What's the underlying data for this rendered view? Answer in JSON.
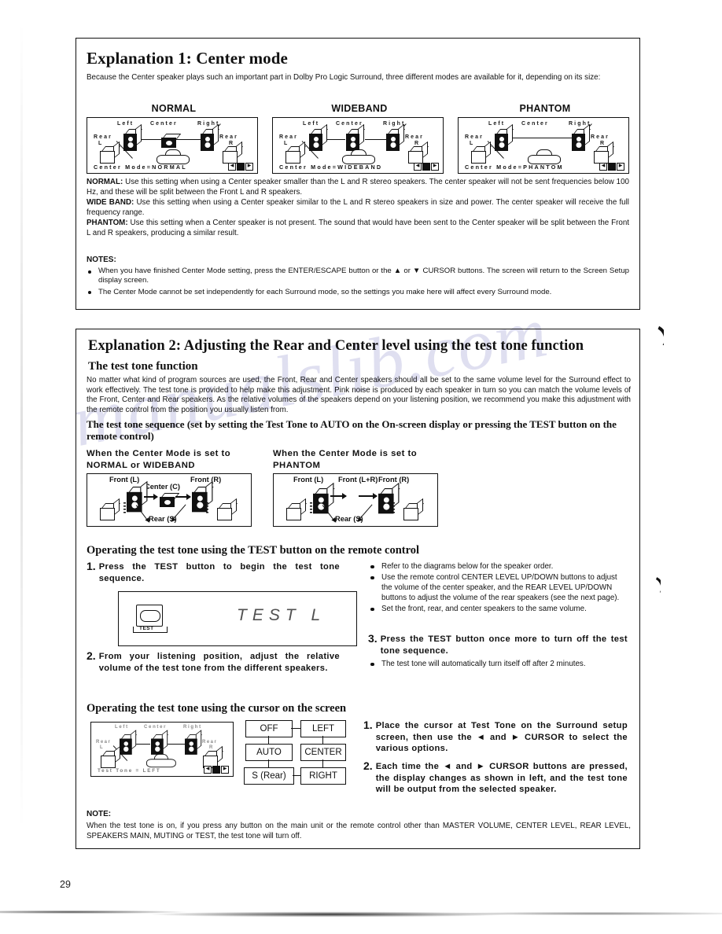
{
  "page": {
    "number": "29",
    "watermark_text": "manualslib.com"
  },
  "explanation1": {
    "heading": "Explanation 1: Center mode",
    "intro": "Because the Center speaker plays such an important part in Dolby Pro Logic Surround, three different modes are available for it, depending on its size:",
    "panels": [
      {
        "title": "NORMAL",
        "osd_top_labels": [
          "Left",
          "Center",
          "Right"
        ],
        "osd_rear_left": "Rear",
        "osd_rear_left_sub": "L",
        "osd_rear_right": "Rear",
        "osd_rear_right_sub": "R",
        "osd_status": "Center Mode=NORMAL",
        "has_center_speaker": true,
        "center_speaker_size": "small"
      },
      {
        "title": "WIDEBAND",
        "osd_top_labels": [
          "Left",
          "Center",
          "Right"
        ],
        "osd_rear_left": "Rear",
        "osd_rear_left_sub": "L",
        "osd_rear_right": "Rear",
        "osd_rear_right_sub": "R",
        "osd_status": "Center Mode=WIDEBAND",
        "has_center_speaker": true,
        "center_speaker_size": "large"
      },
      {
        "title": "PHANTOM",
        "osd_top_labels": [
          "Left",
          "Center",
          "Right"
        ],
        "osd_rear_left": "Rear",
        "osd_rear_left_sub": "L",
        "osd_rear_right": "Rear",
        "osd_rear_right_sub": "R",
        "osd_status": "Center Mode=PHANTOM",
        "has_center_speaker": false,
        "center_speaker_size": "none"
      }
    ],
    "modes": [
      {
        "term": "NORMAL:",
        "text": " Use this setting when using a Center speaker smaller than the L and R stereo speakers. The center speaker will not be sent frequencies below 100 Hz, and these will be split between the Front L and R speakers."
      },
      {
        "term": "WIDE BAND:",
        "text": " Use this setting when using a Center speaker similar to the L and R stereo speakers in size and power. The center speaker will receive the full frequency range."
      },
      {
        "term": "PHANTOM:",
        "text": " Use this setting when a Center speaker is not present. The sound that would have been sent to the Center speaker will be split between the Front L and R speakers, producing a similar result."
      }
    ],
    "notes_title": "NOTES:",
    "notes": [
      "When you have finished Center Mode setting, press the ENTER/ESCAPE button or the ▲ or ▼ CURSOR buttons. The screen will return to the Screen Setup display screen.",
      "The Center Mode cannot be set independently for each Surround mode, so the settings you make here will affect every Surround mode."
    ]
  },
  "explanation2": {
    "heading": "Explanation 2: Adjusting the Rear and Center level using the test tone function",
    "subheading": "The test tone function",
    "intro": "No matter what kind of program sources are used, the Front, Rear and Center speakers should all be set to the same volume level for the Surround effect to work effectively. The test tone is provided to help make this adjustment. Pink noise is produced by each speaker in turn so you can match the volume levels of the Front, Center and Rear speakers. As the relative volumes of the speakers depend on your listening position, we recommend you make this adjustment with the remote control from the position you usually listen from.",
    "sequence_heading": "The test tone sequence (set by setting the Test Tone to AUTO on the On-screen display or pressing the TEST button on the remote control)",
    "layouts": [
      {
        "caption": "When the Center Mode is set to NORMAL or WIDEBAND",
        "labels": [
          "Front (L)",
          "Center (C)",
          "Front (R)",
          "Rear (S)"
        ]
      },
      {
        "caption": "When the Center Mode is set to PHANTOM",
        "labels": [
          "Front (L)",
          "Front (L+R)",
          "Front (R)",
          "Rear (S)"
        ]
      }
    ],
    "remote_section": {
      "heading": "Operating the test tone using the TEST button on the remote control",
      "steps": [
        {
          "num": "1.",
          "text": "Press the TEST button to begin the test tone sequence."
        },
        {
          "num": "2.",
          "text": "From your listening position, adjust the relative volume of the test tone from the different speakers."
        },
        {
          "num": "3.",
          "text": "Press the TEST button once more to turn off the test tone sequence."
        }
      ],
      "display_mock": {
        "button_label": "TEST",
        "display_text": "TEST L"
      },
      "bullets_top": [
        "Refer to the diagrams below for the speaker order.",
        "Use the remote control CENTER LEVEL UP/DOWN buttons to adjust the volume of the center speaker, and the REAR LEVEL UP/DOWN buttons to adjust the volume of the rear speakers (see the next page).",
        "Set the front, rear, and center speakers to the same volume."
      ],
      "bullets_bottom": [
        "The test tone will automatically turn itself off after 2 minutes."
      ]
    },
    "cursor_section": {
      "heading": "Operating the test tone using the cursor on the screen",
      "osd": {
        "top_labels": [
          "Left",
          "Center",
          "Right"
        ],
        "rear_left": "Rear",
        "rear_left_sub": "L",
        "rear_right": "Rear",
        "rear_right_sub": "R",
        "status": "Test Tone = LEFT"
      },
      "flowchart": {
        "options": [
          "OFF",
          "LEFT",
          "AUTO",
          "CENTER",
          "S (Rear)",
          "RIGHT"
        ]
      },
      "steps": [
        {
          "num": "1.",
          "text": "Place the cursor at Test Tone on the Surround setup screen, then use the ◄ and ► CURSOR to select the various options."
        },
        {
          "num": "2.",
          "text": "Each time the ◄ and ► CURSOR buttons are pressed, the display changes as shown in left, and the test tone will be output from the selected speaker."
        }
      ]
    },
    "note_title": "NOTE:",
    "note_text": "When the test tone is on, if you press any button on the main unit or the remote control other than MASTER VOLUME, CENTER LEVEL, REAR LEVEL, SPEAKERS MAIN, MUTING or TEST, the test tone will turn off."
  }
}
